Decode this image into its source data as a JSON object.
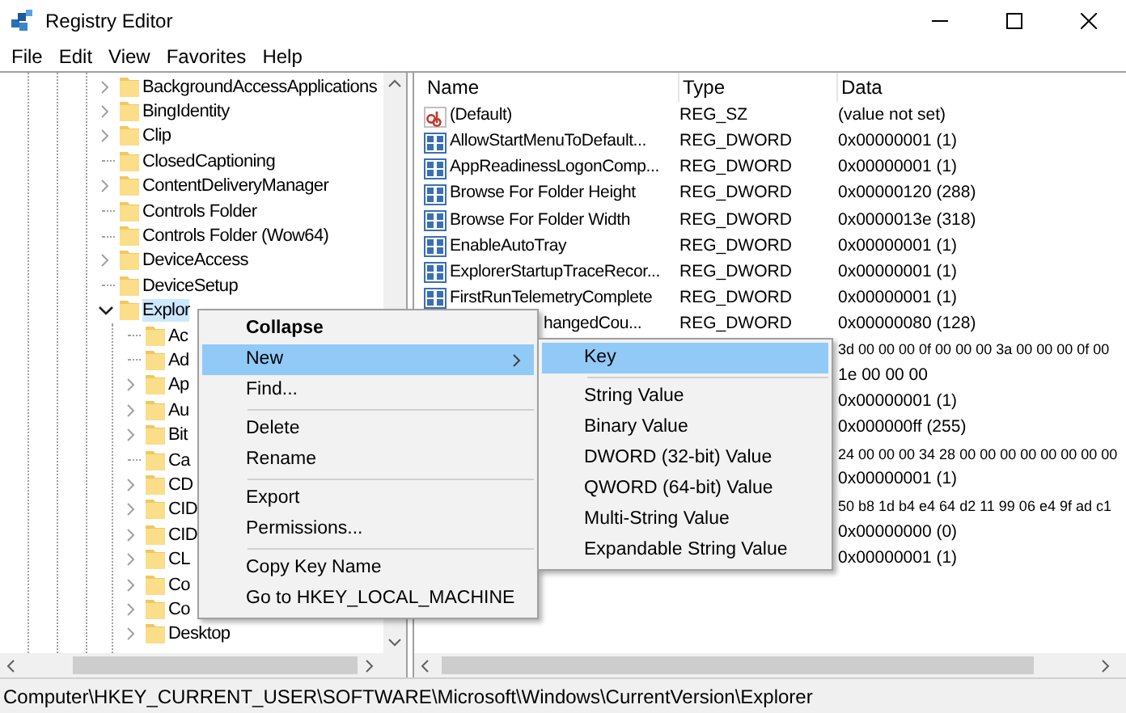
{
  "window": {
    "title": "Registry Editor"
  },
  "menu_bar": [
    "File",
    "Edit",
    "View",
    "Favorites",
    "Help"
  ],
  "tree": [
    {
      "label": "BackgroundAccessApplications",
      "expandable": true,
      "expanded": false,
      "selected": false
    },
    {
      "label": "BingIdentity",
      "expandable": true,
      "expanded": false,
      "selected": false
    },
    {
      "label": "Clip",
      "expandable": true,
      "expanded": false,
      "selected": false
    },
    {
      "label": "ClosedCaptioning",
      "expandable": false,
      "selected": false
    },
    {
      "label": "ContentDeliveryManager",
      "expandable": true,
      "expanded": false,
      "selected": false
    },
    {
      "label": "Controls Folder",
      "expandable": false,
      "selected": false
    },
    {
      "label": "Controls Folder (Wow64)",
      "expandable": false,
      "selected": false
    },
    {
      "label": "DeviceAccess",
      "expandable": true,
      "expanded": false,
      "selected": false
    },
    {
      "label": "DeviceSetup",
      "expandable": false,
      "selected": false
    },
    {
      "label": "Explor",
      "expandable": true,
      "expanded": true,
      "selected": true,
      "children": [
        {
          "label": "Ac",
          "expandable": false,
          "selected": false
        },
        {
          "label": "Ad",
          "expandable": false,
          "selected": false
        },
        {
          "label": "Ap",
          "expandable": true,
          "expanded": false,
          "selected": false
        },
        {
          "label": "Au",
          "expandable": true,
          "expanded": false,
          "selected": false
        },
        {
          "label": "Bit",
          "expandable": true,
          "expanded": false,
          "selected": false
        },
        {
          "label": "Ca",
          "expandable": false,
          "selected": false
        },
        {
          "label": "CD",
          "expandable": true,
          "expanded": false,
          "selected": false
        },
        {
          "label": "CID",
          "expandable": true,
          "expanded": false,
          "selected": false
        },
        {
          "label": "CID",
          "expandable": true,
          "expanded": false,
          "selected": false
        },
        {
          "label": "CL",
          "expandable": true,
          "expanded": false,
          "selected": false
        },
        {
          "label": "Co",
          "expandable": true,
          "expanded": false,
          "selected": false
        },
        {
          "label": "Co",
          "expandable": true,
          "expanded": false,
          "selected": false
        },
        {
          "label": "Desktop",
          "expandable": true,
          "expanded": false,
          "selected": false
        }
      ]
    }
  ],
  "values": {
    "columns": [
      "Name",
      "Type",
      "Data"
    ],
    "rows": [
      {
        "kind": "string",
        "name": "(Default)",
        "type": "REG_SZ",
        "data": "(value not set)"
      },
      {
        "kind": "binary",
        "name": "AllowStartMenuToDefault...",
        "type": "REG_DWORD",
        "data": "0x00000001 (1)"
      },
      {
        "kind": "binary",
        "name": "AppReadinessLogonComp...",
        "type": "REG_DWORD",
        "data": "0x00000001 (1)"
      },
      {
        "kind": "binary",
        "name": "Browse For Folder Height",
        "type": "REG_DWORD",
        "data": "0x00000120 (288)"
      },
      {
        "kind": "binary",
        "name": "Browse For Folder Width",
        "type": "REG_DWORD",
        "data": "0x0000013e (318)"
      },
      {
        "kind": "binary",
        "name": "EnableAutoTray",
        "type": "REG_DWORD",
        "data": "0x00000001 (1)"
      },
      {
        "kind": "binary",
        "name": "ExplorerStartupTraceRecor...",
        "type": "REG_DWORD",
        "data": "0x00000001 (1)"
      },
      {
        "kind": "binary",
        "name": "FirstRunTelemetryComplete",
        "type": "REG_DWORD",
        "data": "0x00000001 (1)"
      },
      {
        "kind": "covered",
        "name": "hangedCou...",
        "type": "REG_DWORD",
        "data": "0x00000080 (128)"
      },
      {
        "kind": "covered",
        "data": "3d 00 00 00 0f 00 00 00 3a 00 00 00 0f 00"
      },
      {
        "kind": "covered",
        "data": "1e 00 00 00"
      },
      {
        "kind": "covered",
        "data": "0x00000001 (1)"
      },
      {
        "kind": "covered",
        "data": "0x000000ff (255)"
      },
      {
        "kind": "covered",
        "data": "24 00 00 00 34 28 00 00 00 00 00 00 00 00"
      },
      {
        "kind": "covered",
        "data": "0x00000001 (1)"
      },
      {
        "kind": "covered",
        "data": "50 b8 1d b4 e4 64 d2 11 99 06 e4 9f ad c1"
      },
      {
        "kind": "covered",
        "data": "0x00000000 (0)"
      },
      {
        "kind": "covered",
        "data": "0x00000001 (1)"
      }
    ]
  },
  "context_menu": {
    "items": [
      {
        "kind": "item",
        "label": "Collapse",
        "default": true,
        "selected": false,
        "submenu": false
      },
      {
        "kind": "item",
        "label": "New",
        "default": false,
        "selected": true,
        "submenu": true
      },
      {
        "kind": "item",
        "label": "Find...",
        "default": false,
        "selected": false,
        "submenu": false
      },
      {
        "kind": "separator"
      },
      {
        "kind": "item",
        "label": "Delete",
        "default": false,
        "selected": false,
        "submenu": false
      },
      {
        "kind": "item",
        "label": "Rename",
        "default": false,
        "selected": false,
        "submenu": false
      },
      {
        "kind": "separator"
      },
      {
        "kind": "item",
        "label": "Export",
        "default": false,
        "selected": false,
        "submenu": false
      },
      {
        "kind": "item",
        "label": "Permissions...",
        "default": false,
        "selected": false,
        "submenu": false
      },
      {
        "kind": "separator"
      },
      {
        "kind": "item",
        "label": "Copy Key Name",
        "default": false,
        "selected": false,
        "submenu": false
      },
      {
        "kind": "item",
        "label": "Go to HKEY_LOCAL_MACHINE",
        "default": false,
        "selected": false,
        "submenu": false
      }
    ]
  },
  "submenu": {
    "items": [
      {
        "kind": "item",
        "label": "Key",
        "selected": true
      },
      {
        "kind": "separator"
      },
      {
        "kind": "item",
        "label": "String Value",
        "selected": false
      },
      {
        "kind": "item",
        "label": "Binary Value",
        "selected": false
      },
      {
        "kind": "item",
        "label": "DWORD (32-bit) Value",
        "selected": false
      },
      {
        "kind": "item",
        "label": "QWORD (64-bit) Value",
        "selected": false
      },
      {
        "kind": "item",
        "label": "Multi-String Value",
        "selected": false
      },
      {
        "kind": "item",
        "label": "Expandable String Value",
        "selected": false
      }
    ]
  },
  "status_bar": {
    "path": "Computer\\HKEY_CURRENT_USER\\SOFTWARE\\Microsoft\\Windows\\CurrentVersion\\Explorer"
  }
}
